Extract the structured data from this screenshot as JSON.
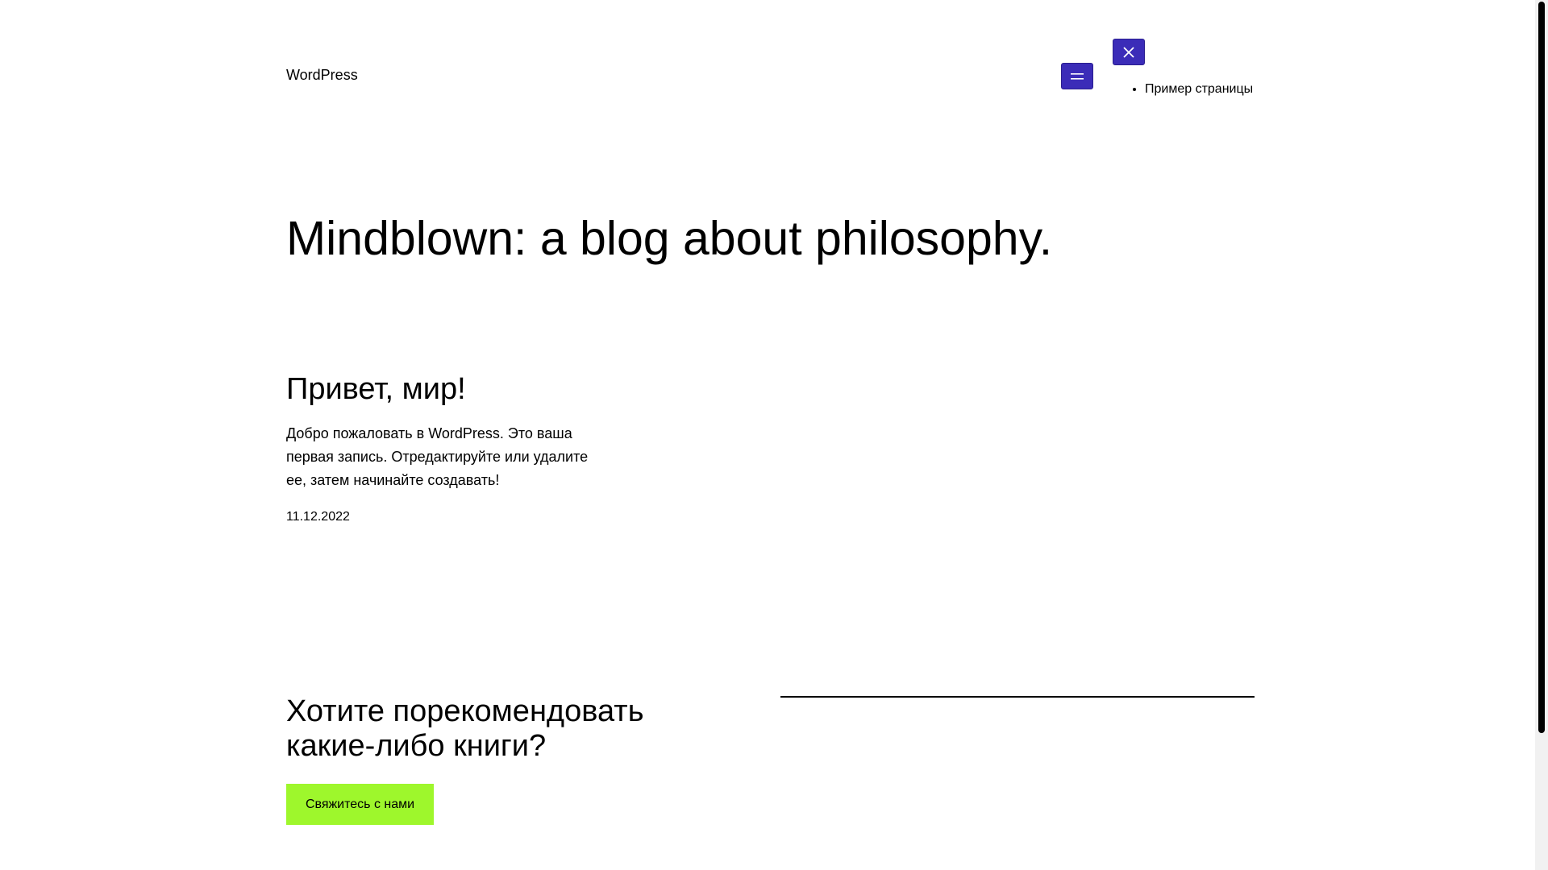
{
  "header": {
    "site_title": "WordPress",
    "open_menu_icon": "hamburger-icon",
    "close_menu_icon": "close-icon",
    "accent_color": "#3b2cb8",
    "nav": {
      "items": [
        {
          "label": "Пример страницы"
        }
      ]
    }
  },
  "hero": {
    "title": "Mindblown: a blog about philosophy."
  },
  "post": {
    "title": "Привет, мир!",
    "excerpt": "Добро пожаловать в WordPress. Это ваша первая запись. Отредактируйте или удалите ее, затем начинайте создавать!",
    "date": "11.12.2022"
  },
  "cta": {
    "title": "Хотите порекомендовать какие-либо книги?",
    "button_label": "Свяжитесь с нами",
    "button_color": "#9ef72c"
  }
}
